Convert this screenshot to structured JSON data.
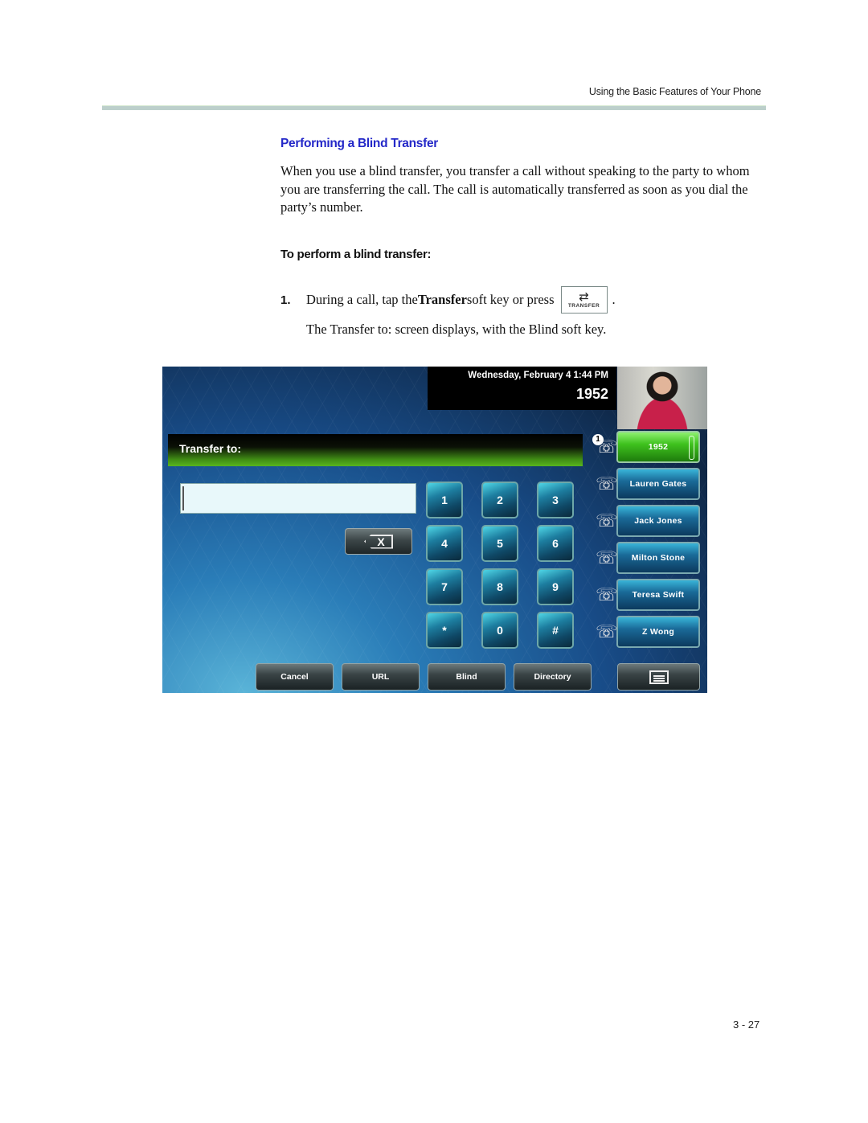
{
  "running_head": "Using the Basic Features of Your Phone",
  "section_title": "Performing a Blind Transfer",
  "intro_paragraph": "When you use a blind transfer, you transfer a call without speaking to the party to whom you are transferring the call. The call is automatically transferred as soon as you dial the party’s number.",
  "procedure_heading": "To perform a blind transfer:",
  "steps": [
    {
      "number": "1.",
      "text_before": "During a call, tap the ",
      "bold": "Transfer",
      "text_after": " soft key or press",
      "hardkey": {
        "icon": "transfer-arrows-icon",
        "label": "TRANSFER"
      },
      "end_punct": ".",
      "result": "The Transfer to: screen displays, with the Blind soft key."
    }
  ],
  "phone_screen": {
    "datetime": "Wednesday, February 4  1:44 PM",
    "line_number": "1952",
    "transfer_label": "Transfer to:",
    "dial_input_value": "",
    "backspace_label": "X",
    "keypad": [
      "1",
      "2",
      "3",
      "4",
      "5",
      "6",
      "7",
      "8",
      "9",
      "*",
      "0",
      "#"
    ],
    "lines": [
      {
        "label": "1952",
        "active": true,
        "badge": "1"
      },
      {
        "label": "Lauren Gates",
        "active": false
      },
      {
        "label": "Jack Jones",
        "active": false
      },
      {
        "label": "Milton Stone",
        "active": false
      },
      {
        "label": "Teresa Swift",
        "active": false
      },
      {
        "label": "Z Wong",
        "active": false
      }
    ],
    "softkeys": [
      "Cancel",
      "URL",
      "Blind",
      "Directory"
    ],
    "menu_softkey_icon": "menu-icon",
    "colors": {
      "active_line": "#3fc21e",
      "title_text": "#2428c8"
    }
  },
  "page_number": "3 - 27"
}
